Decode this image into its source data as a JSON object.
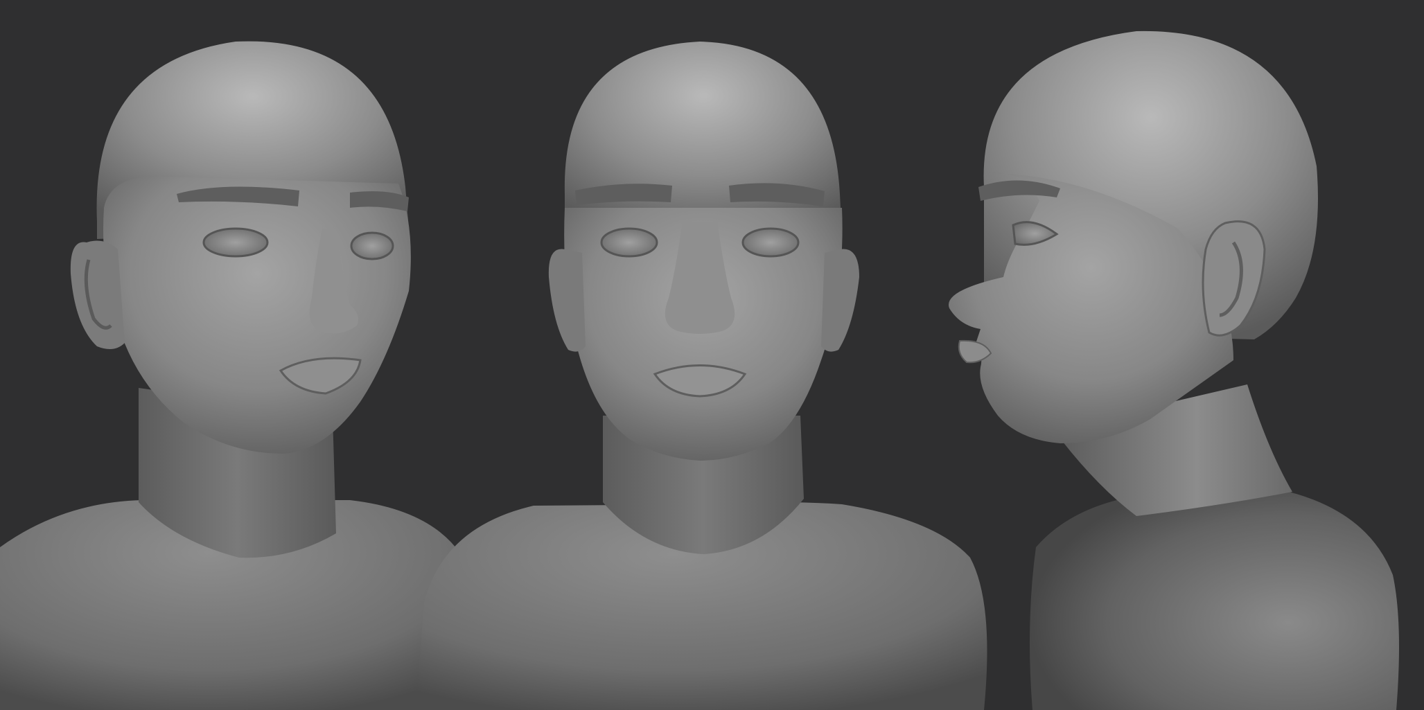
{
  "scene": {
    "background_color": "#2f2f30",
    "clay_color": "#8a8a8a",
    "subject": "clay-render-female-head-sculpt",
    "views": [
      {
        "id": "three-quarter",
        "kind": "three-quarter-view"
      },
      {
        "id": "front",
        "kind": "front-view"
      },
      {
        "id": "profile",
        "kind": "side-profile-view"
      }
    ]
  }
}
